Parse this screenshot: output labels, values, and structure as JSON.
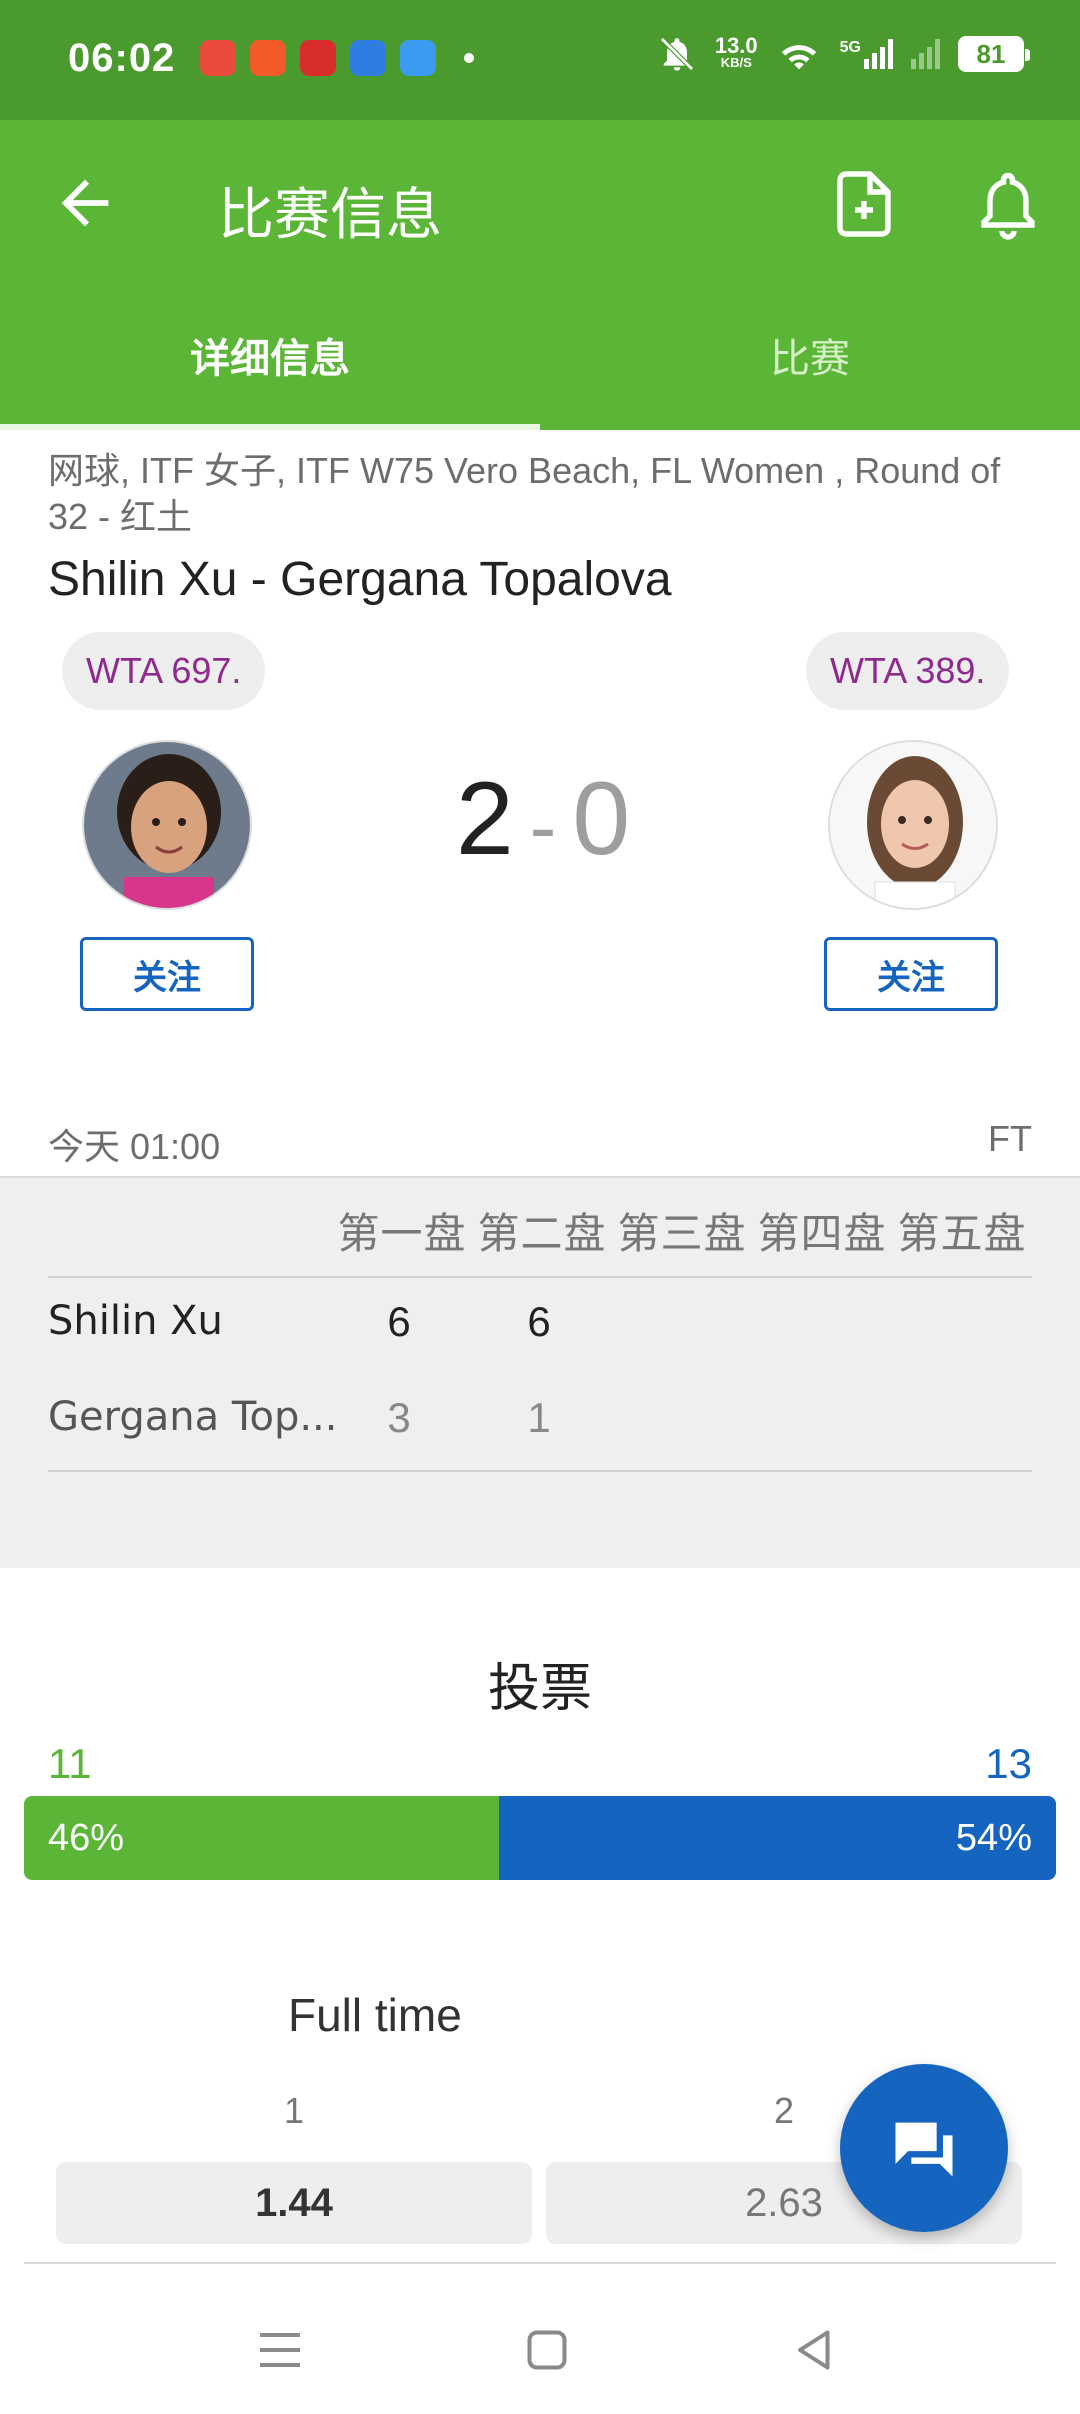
{
  "status_bar": {
    "time": "06:02",
    "net_speed_value": "13.0",
    "net_speed_unit": "KB/S",
    "signal_label": "5G",
    "battery": "81",
    "app_icon_colors": [
      "#e94b3c",
      "#f35a2a",
      "#d92c2c",
      "#2f7de1",
      "#3b9bf0"
    ]
  },
  "app_bar": {
    "title": "比赛信息",
    "back_icon": "arrow-left-icon",
    "add_icon": "add-document-icon",
    "bell_icon": "bell-icon"
  },
  "tabs": [
    {
      "label": "详细信息",
      "active": true
    },
    {
      "label": "比赛",
      "active": false
    }
  ],
  "match": {
    "meta": "网球, ITF 女子, ITF W75 Vero Beach, FL Women , Round of 32 - 红土",
    "matchup": "Shilin Xu - Gergana Topalova",
    "home": {
      "rank": "WTA 697.",
      "follow_label": "关注",
      "score": "2"
    },
    "away": {
      "rank": "WTA 389.",
      "follow_label": "关注",
      "score": "0"
    },
    "score_separator": "-",
    "date": "今天 01:00",
    "status": "FT"
  },
  "sets": {
    "headers": [
      "第一盘",
      "第二盘",
      "第三盘",
      "第四盘",
      "第五盘"
    ],
    "rows": [
      {
        "name": "Shilin Xu",
        "scores": [
          "6",
          "6"
        ]
      },
      {
        "name": "Gergana Top...",
        "scores": [
          "3",
          "1"
        ]
      }
    ]
  },
  "vote": {
    "title": "投票",
    "home_count": "11",
    "away_count": "13",
    "home_percent_label": "46%",
    "away_percent_label": "54%",
    "home_percent": 46,
    "away_percent": 54,
    "home_color": "#5bb536",
    "away_color": "#1565c0"
  },
  "odds": {
    "title": "Full time",
    "labels": [
      "1",
      "2"
    ],
    "values": [
      "1.44",
      "2.63"
    ]
  },
  "fab": {
    "icon": "chat-icon"
  },
  "nav_bar": {
    "icons": [
      "menu-icon",
      "home-square-icon",
      "back-triangle-icon"
    ]
  },
  "colors": {
    "primary_green": "#5bb536",
    "status_green": "#4a9a2e",
    "accent_blue": "#1565c0",
    "rank_purple": "#8e2a8e"
  }
}
